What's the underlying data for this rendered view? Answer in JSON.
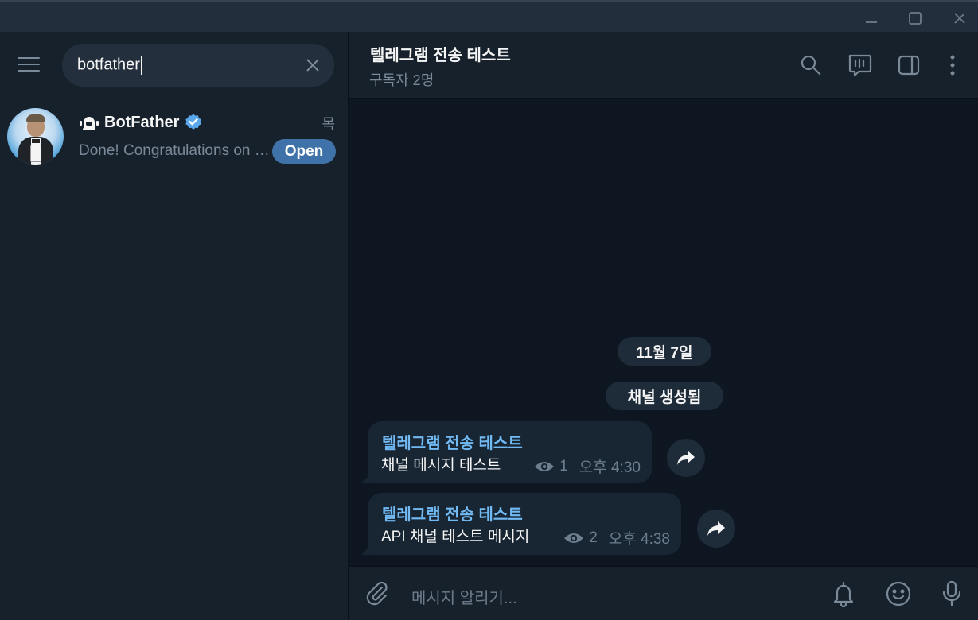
{
  "window": {
    "controls": [
      "minimize-icon",
      "maximize-icon",
      "close-icon"
    ]
  },
  "sidebar": {
    "search": {
      "value": "botfather"
    },
    "chats": [
      {
        "name": "BotFather",
        "time": "목",
        "preview": "Done! Congratulations on your new bot.",
        "badge": "Open",
        "verified": true
      }
    ]
  },
  "header": {
    "title": "텔레그램 전송 테스트",
    "subtitle": "구독자 2명",
    "icons": [
      "search-icon",
      "live-stream-icon",
      "sidebar-toggle-icon",
      "more-vertical-icon"
    ]
  },
  "messages": {
    "date_pill": "11월 7일",
    "service_pill": "채널 생성됨",
    "items": [
      {
        "author": "텔레그램 전송 테스트",
        "text": "채널 메시지 테스트",
        "views": "1",
        "time": "오후 4:30"
      },
      {
        "author": "텔레그램 전송 테스트",
        "text": "API 채널 테스트 메시지",
        "views": "2",
        "time": "오후 4:38"
      }
    ]
  },
  "composer": {
    "placeholder": "메시지 알리기...",
    "icons": [
      "attach-icon",
      "bell-icon",
      "emoji-icon",
      "microphone-icon"
    ]
  },
  "colors": {
    "accent": "#71baf4",
    "badge": "#3e72a8",
    "background": "#0e1621",
    "panel": "#17212b",
    "bubble": "#182533"
  }
}
